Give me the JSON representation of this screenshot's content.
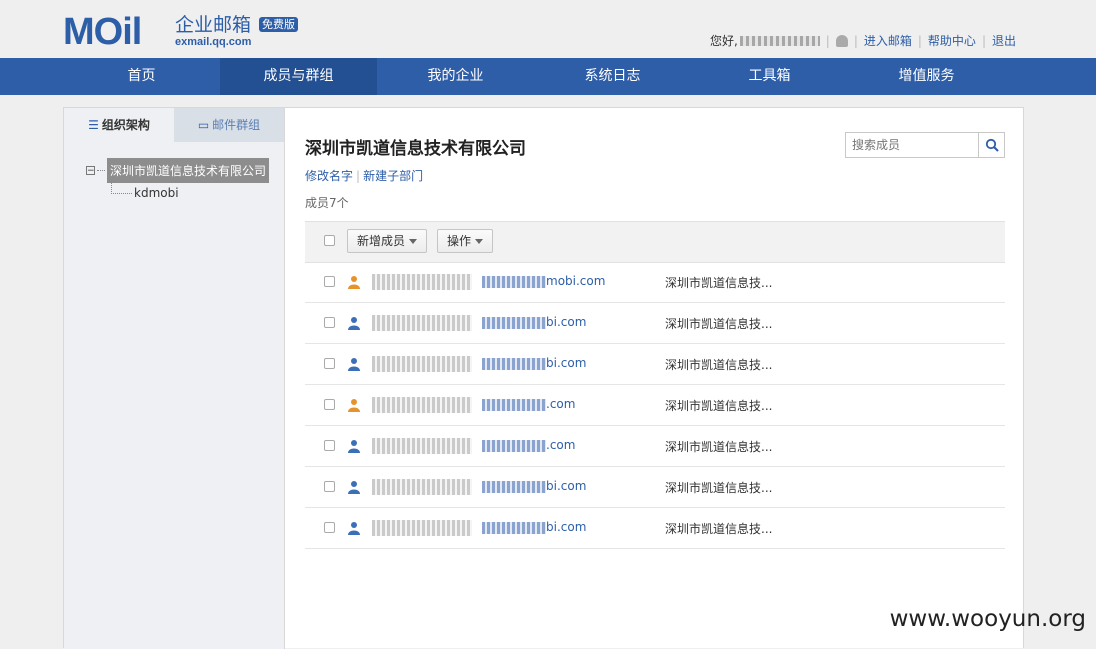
{
  "header": {
    "logo_text": "MOil",
    "logo_title": "企业邮箱",
    "logo_badge": "免费版",
    "logo_domain": "exmail.qq.com",
    "greeting": "您好,",
    "links": [
      "进入邮箱",
      "帮助中心",
      "退出"
    ]
  },
  "nav": {
    "items": [
      "首页",
      "成员与群组",
      "我的企业",
      "系统日志",
      "工具箱",
      "增值服务"
    ],
    "active": "成员与群组"
  },
  "sidebar": {
    "tab_org": "组织架构",
    "tab_groups": "邮件群组",
    "tree_root": "深圳市凯道信息技术有限公司",
    "tree_child": "kdmobi"
  },
  "main": {
    "org_title": "深圳市凯道信息技术有限公司",
    "link_rename": "修改名字",
    "link_new_dept": "新建子部门",
    "member_count": "成员7个",
    "search_placeholder": "搜索成员",
    "btn_add_member": "新增成员",
    "btn_actions": "操作"
  },
  "members": [
    {
      "email_suffix": "mobi.com",
      "dept": "深圳市凯道信息技...",
      "icon_color": "#e8922a"
    },
    {
      "email_suffix": "bi.com",
      "dept": "深圳市凯道信息技...",
      "icon_color": "#3b6fb6"
    },
    {
      "email_suffix": "bi.com",
      "dept": "深圳市凯道信息技...",
      "icon_color": "#3b6fb6"
    },
    {
      "email_suffix": ".com",
      "dept": "深圳市凯道信息技...",
      "icon_color": "#e8922a"
    },
    {
      "email_suffix": ".com",
      "dept": "深圳市凯道信息技...",
      "icon_color": "#3b6fb6"
    },
    {
      "email_suffix": "bi.com",
      "dept": "深圳市凯道信息技...",
      "icon_color": "#3b6fb6"
    },
    {
      "email_suffix": "bi.com",
      "dept": "深圳市凯道信息技...",
      "icon_color": "#3b6fb6"
    }
  ],
  "watermark": "www.wooyun.org"
}
